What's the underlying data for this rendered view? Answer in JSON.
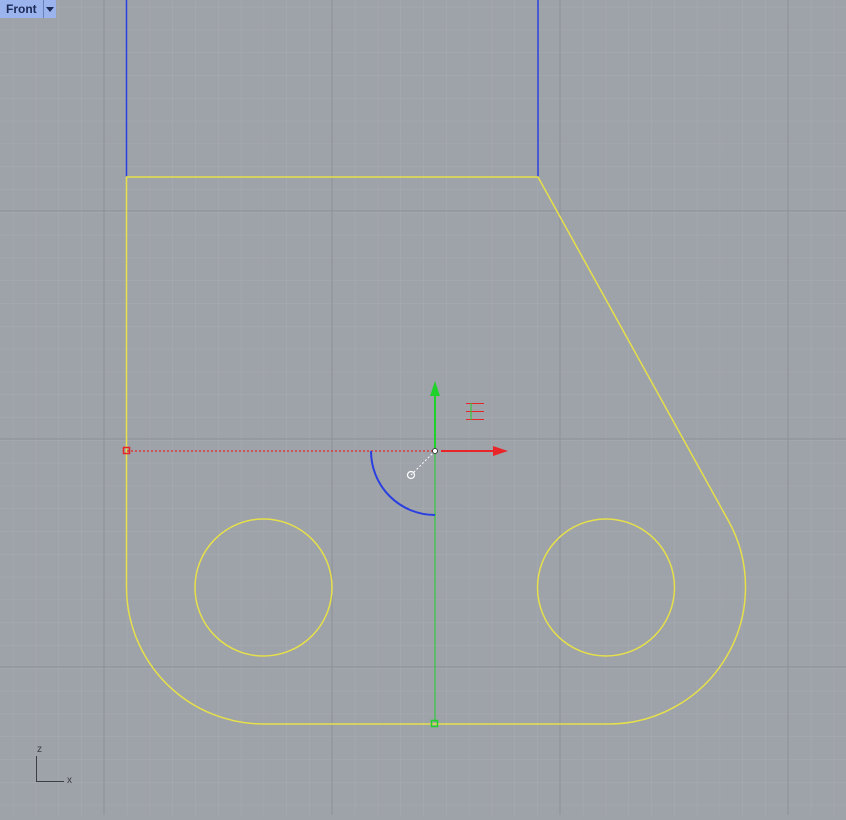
{
  "viewport": {
    "name": "Front",
    "axes": {
      "vertical": "z",
      "horizontal": "x"
    }
  },
  "colors": {
    "background": "#9ea2a9",
    "grid_minor": "#a7abb1",
    "grid_major": "#8d9198",
    "curve": "#e6e04a",
    "blue": "#2a3fe0",
    "gizmo_x": "#e8262a",
    "gizmo_z": "#1fd22a"
  },
  "icons": {
    "viewport_menu": "triangle-down-icon",
    "gizmo_x_arrow": "arrow-right-icon",
    "gizmo_z_arrow": "arrow-up-icon"
  }
}
